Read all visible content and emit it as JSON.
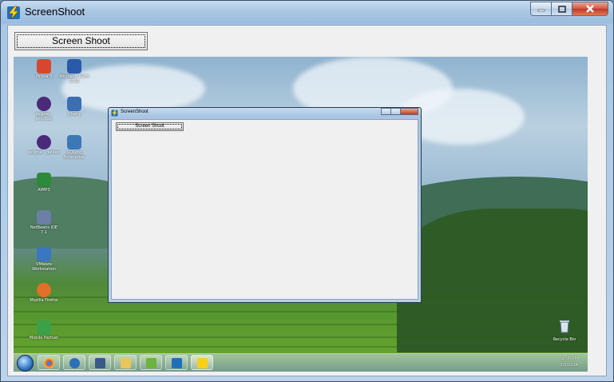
{
  "window": {
    "title": "ScreenShoot",
    "app_icon": "lightning-app-icon",
    "controls": [
      "minimize-icon",
      "maximize-icon",
      "close-icon"
    ]
  },
  "toolbar": {
    "screen_shoot_label": "Screen Shoot"
  },
  "capture": {
    "nested_window": {
      "title": "ScreenShoot",
      "button_label": "Screen Shoot"
    },
    "desktop_icons": [
      {
        "label": "Picasa 3",
        "color": "#d9462e"
      },
      {
        "label": "Microsoft Word 2010",
        "color": "#2a5aa8"
      },
      {
        "label": "eclipse - shortcut",
        "color": "#4b2a7a"
      },
      {
        "label": "jQuery",
        "color": "#3b6fb0"
      },
      {
        "label": "eclipse - galileo",
        "color": "#4b2a7a"
      },
      {
        "label": "SQLyog Enterprise",
        "color": "#3c78b8"
      },
      {
        "label": "AIMP3",
        "color": "#2d8a3a"
      },
      {
        "label": "NetBeans IDE 7.1",
        "color": "#6d7fa6"
      },
      {
        "label": "VMware Workstation",
        "color": "#3a76c2"
      },
      {
        "label": "Mozilla Firefox",
        "color": "#e0702a"
      },
      {
        "label": "Mobile Partner",
        "color": "#3aa04a"
      }
    ],
    "recycle_bin_label": "Recycle Bin",
    "clock": {
      "time": "2:00 PM",
      "date": "3/1/2014"
    }
  }
}
